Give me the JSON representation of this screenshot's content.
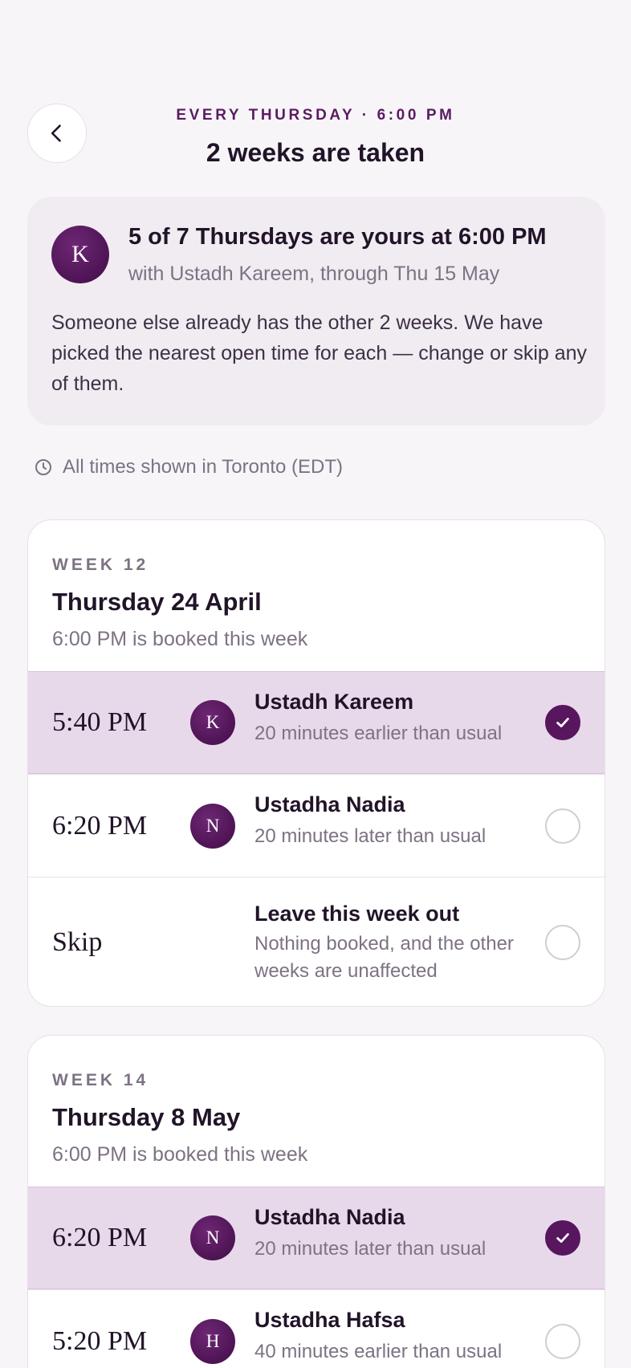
{
  "header": {
    "eyebrow": "EVERY THURSDAY · 6:00 PM",
    "title": "2 weeks are taken"
  },
  "summary": {
    "avatar_initial": "K",
    "title": "5 of 7 Thursdays are yours at 6:00 PM",
    "subtitle": "with Ustadh Kareem, through Thu 15 May",
    "body": "Someone else already has the other 2 weeks. We have picked the nearest open time for each — change or skip any of them."
  },
  "timezone": {
    "icon": "clock-icon",
    "text": "All times shown in Toronto (EDT)"
  },
  "weeks": [
    {
      "label": "WEEK 12",
      "date": "Thursday 24 April",
      "note": "6:00 PM is booked this week",
      "options": [
        {
          "time": "5:40 PM",
          "avatar": "K",
          "name": "Ustadh Kareem",
          "detail": "20 minutes earlier than usual",
          "selected": true
        },
        {
          "time": "6:20 PM",
          "avatar": "N",
          "name": "Ustadha Nadia",
          "detail": "20 minutes later than usual",
          "selected": false
        },
        {
          "time": "Skip",
          "avatar": "",
          "name": "Leave this week out",
          "detail": "Nothing booked, and the other weeks are unaffected",
          "selected": false
        }
      ]
    },
    {
      "label": "WEEK 14",
      "date": "Thursday 8 May",
      "note": "6:00 PM is booked this week",
      "options": [
        {
          "time": "6:20 PM",
          "avatar": "N",
          "name": "Ustadha Nadia",
          "detail": "20 minutes later than usual",
          "selected": true
        },
        {
          "time": "5:20 PM",
          "avatar": "H",
          "name": "Ustadha Hafsa",
          "detail": "40 minutes earlier than usual",
          "selected": false
        }
      ]
    }
  ],
  "colors": {
    "accent": "#57165d",
    "selected_bg": "#e8d9ea",
    "page_bg": "#f7f5f8",
    "summary_bg": "#f1ecf2"
  }
}
